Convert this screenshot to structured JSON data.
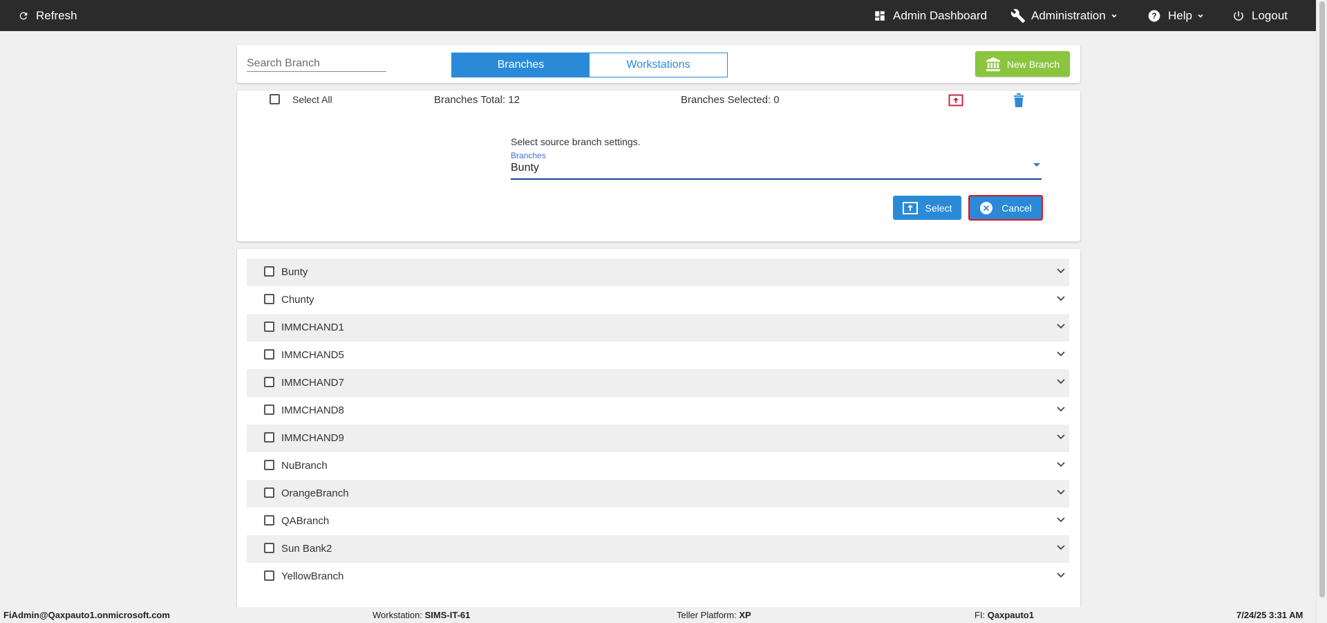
{
  "topbar": {
    "refresh_label": "Refresh",
    "admin_dashboard_label": "Admin Dashboard",
    "administration_label": "Administration",
    "help_label": "Help",
    "logout_label": "Logout"
  },
  "header": {
    "search_placeholder": "Search Branch",
    "tabs": [
      {
        "label": "Branches",
        "active": true
      },
      {
        "label": "Workstations",
        "active": false
      }
    ],
    "new_branch_label": "New Branch",
    "new_branch_color": "#8bc53f"
  },
  "actions": {
    "select_all_label": "Select All",
    "branches_total": "Branches Total: 12",
    "branches_selected": "Branches Selected: 0",
    "prompt": "Select source branch settings.",
    "dropdown_label": "Branches",
    "dropdown_value": "Bunty",
    "select_button_label": "Select",
    "cancel_button_label": "Cancel",
    "accent_color": "#2b8ad8",
    "highlight_color": "#e0141e"
  },
  "branches": [
    "Bunty",
    "Chunty",
    "IMMCHAND1",
    "IMMCHAND5",
    "IMMCHAND7",
    "IMMCHAND8",
    "IMMCHAND9",
    "NuBranch",
    "OrangeBranch",
    "QABranch",
    "Sun Bank2",
    "YellowBranch"
  ],
  "footer": {
    "user": "FiAdmin@Qaxpauto1.onmicrosoft.com",
    "workstation_label": "Workstation: ",
    "workstation_value": "SIMS-IT-61",
    "platform_label": "Teller Platform: ",
    "platform_value": "XP",
    "fi_label": "FI: ",
    "fi_value": "Qaxpauto1",
    "datetime": "7/24/25 3:31 AM"
  }
}
